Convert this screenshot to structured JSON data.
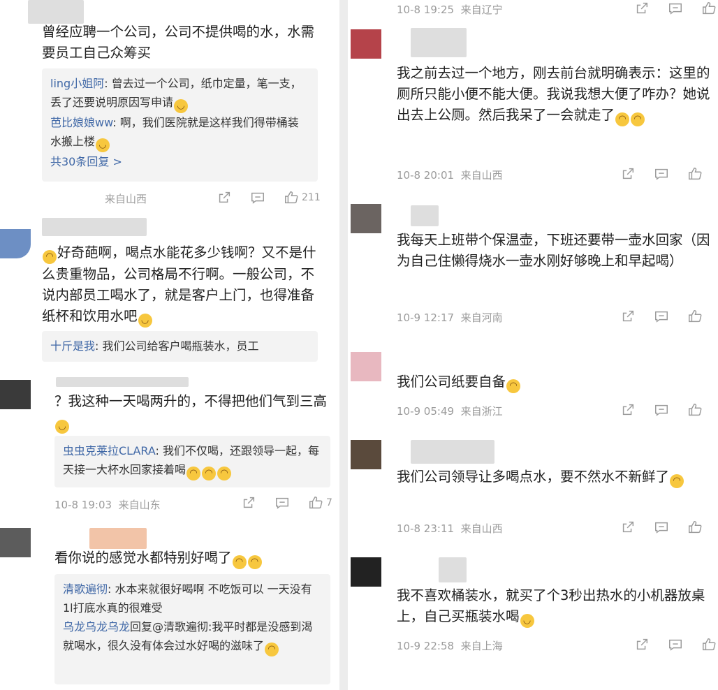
{
  "left": {
    "c1": {
      "text": "曾经应聘一个公司，公司不提供喝的水，水需要员工自己众筹买",
      "replies": [
        {
          "user": "ling小姐阿",
          "text": ": 曾去过一个公司，纸巾定量，笔一支，丢了还要说明原因写申请"
        },
        {
          "user": "芭比娘娘ww",
          "text": ": 啊，我们医院就是这样我们得带桶装水搬上楼"
        }
      ],
      "more": "共30条回复 >",
      "meta": "来自山西",
      "likes": "211"
    },
    "c2": {
      "text": "好奇葩啊，喝点水能花多少钱啊？又不是什么贵重物品，公司格局不行啊。一般公司，不说内部员工喝水了，就是客户上门，也得准备纸杯和饮用水吧",
      "reply_user": "十斤是我",
      "reply_text": ": 我们公司给客户喝瓶装水，员工"
    },
    "c3": {
      "text": "？我这种一天喝两升的，不得把他们气到三高",
      "reply_user": "虫虫克莱拉CLARA",
      "reply_text": ": 我们不仅喝，还跟领导一起，每天接一大杯水回家接着喝",
      "time": "10-8 19:03",
      "from": "来自山东",
      "likes": "7"
    },
    "c4": {
      "text": "看你说的感觉水都特别好喝了",
      "replies": [
        {
          "user": "清歌遍彻",
          "text": ": 水本来就很好喝啊 不吃饭可以 一天没有1l打底水真的很难受"
        },
        {
          "user": "乌龙乌龙乌龙",
          "text": "回复@清歌遍彻:我平时都是没感到渴就喝水，很久没有体会过水好喝的滋味了"
        }
      ]
    }
  },
  "right": {
    "top_meta": {
      "time": "10-8 19:25",
      "from": "来自辽宁"
    },
    "r1": {
      "text": "我之前去过一个地方，刚去前台就明确表示：这里的厕所只能小便不能大便。我说我想大便了咋办？她说出去上公厕。然后我呆了一会就走了",
      "time": "10-8 20:01",
      "from": "来自山西"
    },
    "r2": {
      "text": "我每天上班带个保温壶，下班还要带一壶水回家（因为自己住懒得烧水一壶水刚好够晚上和早起喝）",
      "time": "10-9 12:17",
      "from": "来自河南"
    },
    "r3": {
      "text": "我们公司纸要自备",
      "time": "10-9 05:49",
      "from": "来自浙江"
    },
    "r4": {
      "text": "我们公司领导让多喝点水，要不然水不新鲜了",
      "time": "10-8 23:11",
      "from": "来自山西"
    },
    "r5": {
      "text": "我不喜欢桶装水，就买了个3秒出热水的小机器放桌上，自己买瓶装水喝",
      "time": "10-9 22:58",
      "from": "来自上海"
    }
  },
  "colors": {
    "link": "#3f67a6",
    "meta": "#9b9b9b",
    "reply_bg": "#f3f3f3"
  },
  "icon_names": [
    "share-icon",
    "comment-icon",
    "like-icon",
    "emoji-icon"
  ]
}
